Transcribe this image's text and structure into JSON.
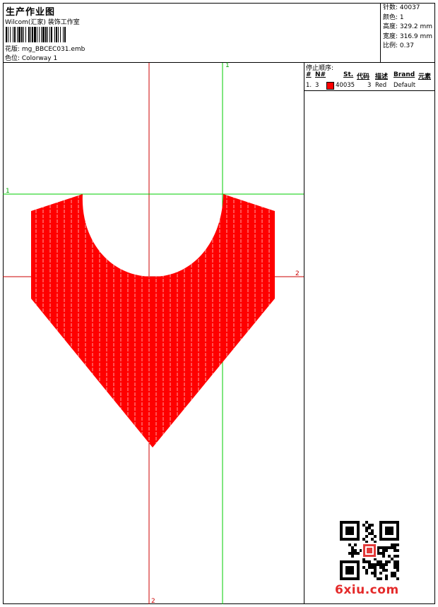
{
  "header": {
    "title": "生产作业图",
    "subtitle": "Wilcom(汇家) 装饰工作室",
    "pattern": "花版: mg_BBCEC031.emb",
    "colorway": "色位: Colorway 1"
  },
  "stats": [
    "针数: 40037",
    "颜色: 1",
    "高度: 329.2 mm",
    "宽度: 316.9 mm",
    "比例: 0.37"
  ],
  "stop_sequence": {
    "title": "停止顺序:",
    "columns": [
      "#",
      "N#",
      "St.",
      "代码",
      "描述",
      "Brand",
      "元素"
    ],
    "rows": [
      {
        "index": "1.",
        "n": "3",
        "stitches": "40035",
        "code": "3",
        "description": "Red",
        "brand": "Default",
        "color": "#ff0000"
      }
    ]
  },
  "guides": {
    "green_v_label": "1",
    "green_h_label": "1",
    "red_h_label": "2",
    "red_v_label": "2"
  },
  "colors": {
    "fill": "#ff0000",
    "guide_red": "#cc0000",
    "guide_green": "#00cc00"
  },
  "watermark": "6xiu.com"
}
